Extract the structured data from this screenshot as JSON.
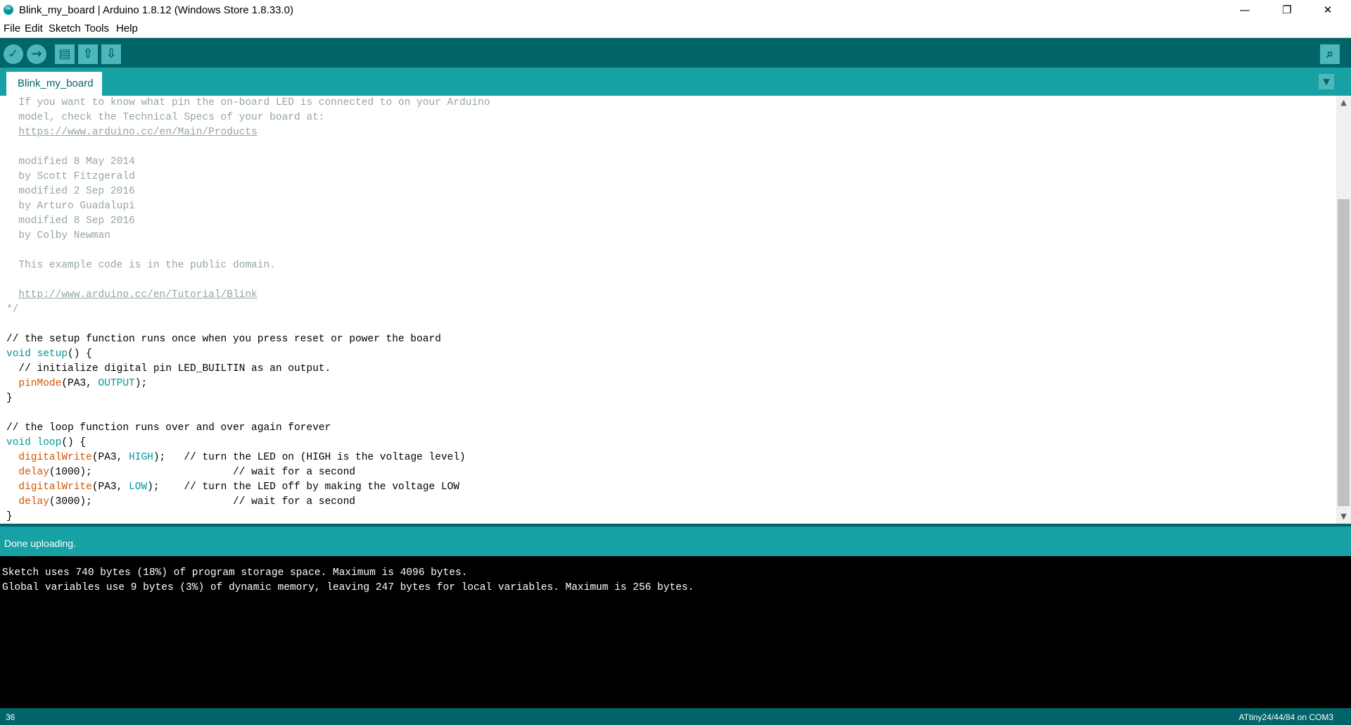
{
  "window": {
    "title": "Blink_my_board | Arduino 1.8.12 (Windows Store 1.8.33.0)",
    "minimize_glyph": "—",
    "maximize_glyph": "❐",
    "close_glyph": "✕"
  },
  "menu": [
    "File",
    "Edit",
    "Sketch",
    "Tools",
    "Help"
  ],
  "toolbar": {
    "verify_glyph": "✓",
    "upload_glyph": "→",
    "new_glyph": "▤",
    "open_glyph": "⇧",
    "save_glyph": "⇩",
    "serial_glyph": "⌕"
  },
  "tabs": [
    {
      "label": "Blink_my_board"
    }
  ],
  "tab_menu_glyph": "▼",
  "editor": {
    "lines": [
      {
        "tokens": [
          {
            "t": "  If you want to know what pin the on-board LED is connected to on your Arduino",
            "c": "comment"
          }
        ]
      },
      {
        "tokens": [
          {
            "t": "  model, check the Technical Specs of your board at:",
            "c": "comment"
          }
        ]
      },
      {
        "tokens": [
          {
            "t": "  ",
            "c": "comment"
          },
          {
            "t": "https://www.arduino.cc/en/Main/Products",
            "c": "link"
          }
        ]
      },
      {
        "tokens": []
      },
      {
        "tokens": [
          {
            "t": "  modified 8 May 2014",
            "c": "comment"
          }
        ]
      },
      {
        "tokens": [
          {
            "t": "  by Scott Fitzgerald",
            "c": "comment"
          }
        ]
      },
      {
        "tokens": [
          {
            "t": "  modified 2 Sep 2016",
            "c": "comment"
          }
        ]
      },
      {
        "tokens": [
          {
            "t": "  by Arturo Guadalupi",
            "c": "comment"
          }
        ]
      },
      {
        "tokens": [
          {
            "t": "  modified 8 Sep 2016",
            "c": "comment"
          }
        ]
      },
      {
        "tokens": [
          {
            "t": "  by Colby Newman",
            "c": "comment"
          }
        ]
      },
      {
        "tokens": []
      },
      {
        "tokens": [
          {
            "t": "  This example code is in the public domain.",
            "c": "comment"
          }
        ]
      },
      {
        "tokens": []
      },
      {
        "tokens": [
          {
            "t": "  ",
            "c": "comment"
          },
          {
            "t": "http://www.arduino.cc/en/Tutorial/Blink",
            "c": "link"
          }
        ]
      },
      {
        "tokens": [
          {
            "t": "*/",
            "c": "comment"
          }
        ]
      },
      {
        "tokens": []
      },
      {
        "tokens": [
          {
            "t": "// the setup function runs once when you press reset or power the board",
            "c": "plain"
          }
        ]
      },
      {
        "tokens": [
          {
            "t": "void",
            "c": "kw"
          },
          {
            "t": " ",
            "c": "plain"
          },
          {
            "t": "setup",
            "c": "kw"
          },
          {
            "t": "() {",
            "c": "plain"
          }
        ]
      },
      {
        "tokens": [
          {
            "t": "  // initialize digital pin LED_BUILTIN as an output.",
            "c": "plain"
          }
        ]
      },
      {
        "tokens": [
          {
            "t": "  ",
            "c": "plain"
          },
          {
            "t": "pinMode",
            "c": "fn"
          },
          {
            "t": "(PA3, ",
            "c": "plain"
          },
          {
            "t": "OUTPUT",
            "c": "const"
          },
          {
            "t": ");",
            "c": "plain"
          }
        ]
      },
      {
        "tokens": [
          {
            "t": "}",
            "c": "plain"
          }
        ]
      },
      {
        "tokens": []
      },
      {
        "tokens": [
          {
            "t": "// the loop function runs over and over again forever",
            "c": "plain"
          }
        ]
      },
      {
        "tokens": [
          {
            "t": "void",
            "c": "kw"
          },
          {
            "t": " ",
            "c": "plain"
          },
          {
            "t": "loop",
            "c": "kw"
          },
          {
            "t": "() {",
            "c": "plain"
          }
        ]
      },
      {
        "tokens": [
          {
            "t": "  ",
            "c": "plain"
          },
          {
            "t": "digitalWrite",
            "c": "fn"
          },
          {
            "t": "(PA3, ",
            "c": "plain"
          },
          {
            "t": "HIGH",
            "c": "const"
          },
          {
            "t": ");   // turn the LED on (HIGH is the voltage level)",
            "c": "plain"
          }
        ]
      },
      {
        "tokens": [
          {
            "t": "  ",
            "c": "plain"
          },
          {
            "t": "delay",
            "c": "fn"
          },
          {
            "t": "(1000);                       // wait for a second",
            "c": "plain"
          }
        ]
      },
      {
        "tokens": [
          {
            "t": "  ",
            "c": "plain"
          },
          {
            "t": "digitalWrite",
            "c": "fn"
          },
          {
            "t": "(PA3, ",
            "c": "plain"
          },
          {
            "t": "LOW",
            "c": "const"
          },
          {
            "t": ");    // turn the LED off by making the voltage LOW",
            "c": "plain"
          }
        ]
      },
      {
        "tokens": [
          {
            "t": "  ",
            "c": "plain"
          },
          {
            "t": "delay",
            "c": "fn"
          },
          {
            "t": "(3000);                       // wait for a second",
            "c": "plain"
          }
        ]
      },
      {
        "tokens": [
          {
            "t": "}",
            "c": "plain"
          }
        ]
      }
    ]
  },
  "scrollbar": {
    "up_glyph": "▲",
    "down_glyph": "▼"
  },
  "status": {
    "message": "Done uploading."
  },
  "console": {
    "lines": [
      "Sketch uses 740 bytes (18%) of program storage space. Maximum is 4096 bytes.",
      "Global variables use 9 bytes (3%) of dynamic memory, leaving 247 bytes for local variables. Maximum is 256 bytes."
    ]
  },
  "footer": {
    "line_number": "36",
    "board": "ATtiny24/44/84 on COM3"
  },
  "colors": {
    "teal_dark": "#006468",
    "teal_mid": "#17a1a5",
    "button": "#4db7bb",
    "comment": "#95a5a6",
    "keyword": "#00979c",
    "function": "#d35400"
  }
}
